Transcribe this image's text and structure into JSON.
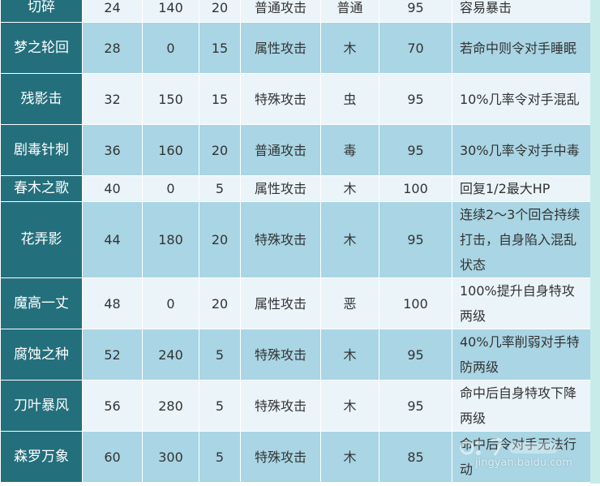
{
  "skills_table": {
    "rows": [
      {
        "name": "切碎",
        "level": "24",
        "power": "140",
        "pp": "20",
        "category": "普通攻击",
        "type": "普通",
        "accuracy": "95",
        "effect": "容易暴击"
      },
      {
        "name": "梦之轮回",
        "level": "28",
        "power": "0",
        "pp": "15",
        "category": "属性攻击",
        "type": "木",
        "accuracy": "70",
        "effect": "若命中则令对手睡眠"
      },
      {
        "name": "残影击",
        "level": "32",
        "power": "150",
        "pp": "15",
        "category": "特殊攻击",
        "type": "虫",
        "accuracy": "95",
        "effect": "10%几率令对手混乱"
      },
      {
        "name": "剧毒针刺",
        "level": "36",
        "power": "160",
        "pp": "20",
        "category": "普通攻击",
        "type": "毒",
        "accuracy": "95",
        "effect": "30%几率令对手中毒"
      },
      {
        "name": "春木之歌",
        "level": "40",
        "power": "0",
        "pp": "5",
        "category": "属性攻击",
        "type": "木",
        "accuracy": "100",
        "effect": "回复1/2最大HP"
      },
      {
        "name": "花弄影",
        "level": "44",
        "power": "180",
        "pp": "20",
        "category": "特殊攻击",
        "type": "木",
        "accuracy": "95",
        "effect": "连续2～3个回合持续打击，自身陷入混乱状态"
      },
      {
        "name": "魔高一丈",
        "level": "48",
        "power": "0",
        "pp": "20",
        "category": "属性攻击",
        "type": "恶",
        "accuracy": "100",
        "effect": "100%提升自身特攻两级"
      },
      {
        "name": "腐蚀之种",
        "level": "52",
        "power": "240",
        "pp": "5",
        "category": "特殊攻击",
        "type": "木",
        "accuracy": "95",
        "effect": "40%几率削弱对手特防两级"
      },
      {
        "name": "刀叶暴风",
        "level": "56",
        "power": "280",
        "pp": "5",
        "category": "特殊攻击",
        "type": "木",
        "accuracy": "95",
        "effect": "命中后自身特攻下降两级"
      },
      {
        "name": "森罗万象",
        "level": "60",
        "power": "300",
        "pp": "5",
        "category": "特殊攻击",
        "type": "木",
        "accuracy": "85",
        "effect": "命中后令对手无法行动"
      }
    ]
  },
  "watermark": {
    "text": "jingyan.baidu.com",
    "logo_icon": "baidu-jingyan-logo-icon"
  },
  "colors": {
    "name_column": "#246f7c",
    "row_light": "#eaf4f9",
    "row_dark": "#a9d5e4",
    "edge_strip": "#c7ebe9"
  }
}
